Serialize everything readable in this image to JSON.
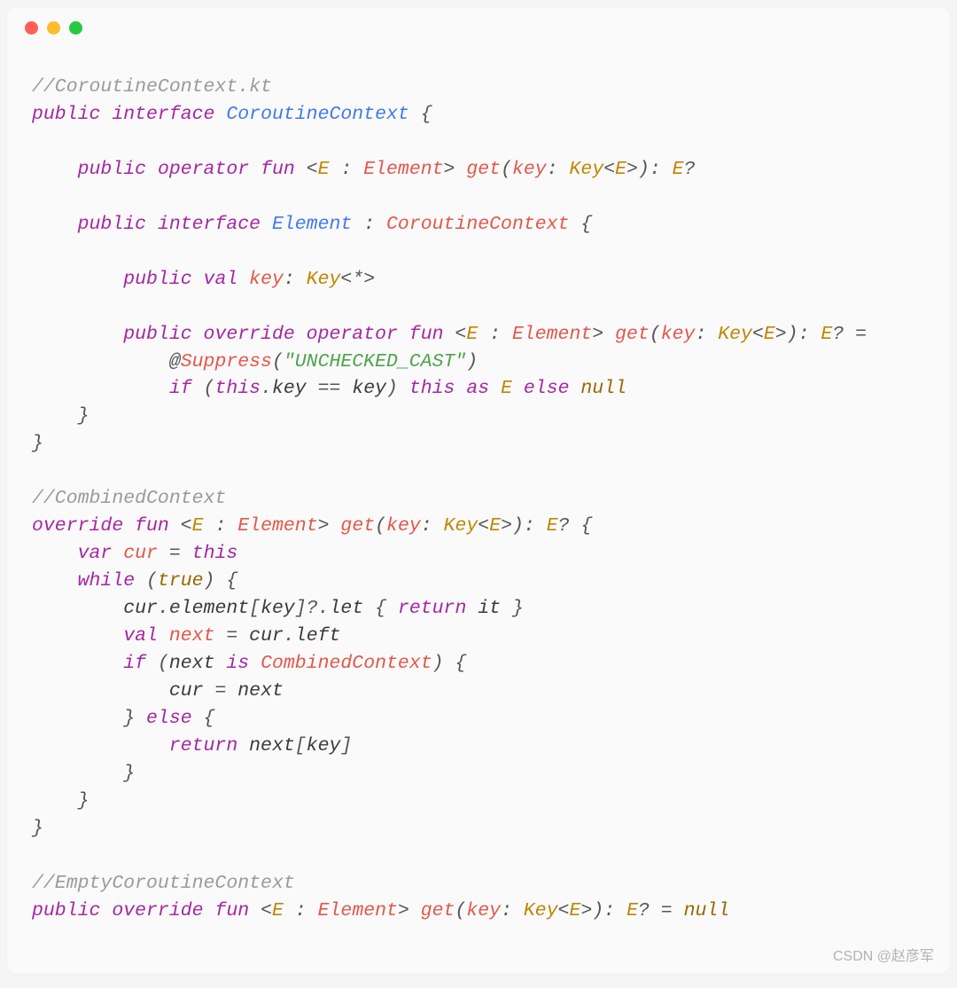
{
  "watermark": "CSDN @赵彦军",
  "code": {
    "lines": [
      [
        [
          "c-comment",
          "//CoroutineContext.kt"
        ]
      ],
      [
        [
          "c-kw",
          "public"
        ],
        [
          "sp",
          " "
        ],
        [
          "c-kw",
          "interface"
        ],
        [
          "sp",
          " "
        ],
        [
          "c-class",
          "CoroutineContext"
        ],
        [
          "sp",
          " "
        ],
        [
          "c-punc",
          "{"
        ]
      ],
      [],
      [
        [
          "sp",
          "    "
        ],
        [
          "c-kw",
          "public"
        ],
        [
          "sp",
          " "
        ],
        [
          "c-kw",
          "operator"
        ],
        [
          "sp",
          " "
        ],
        [
          "c-kw",
          "fun"
        ],
        [
          "sp",
          " "
        ],
        [
          "c-punc",
          "<"
        ],
        [
          "c-type",
          "E"
        ],
        [
          "sp",
          " "
        ],
        [
          "c-punc",
          ":"
        ],
        [
          "sp",
          " "
        ],
        [
          "c-fn",
          "Element"
        ],
        [
          "c-punc",
          ">"
        ],
        [
          "sp",
          " "
        ],
        [
          "c-fn",
          "get"
        ],
        [
          "c-punc",
          "("
        ],
        [
          "c-param",
          "key"
        ],
        [
          "c-punc",
          ":"
        ],
        [
          "sp",
          " "
        ],
        [
          "c-type",
          "Key"
        ],
        [
          "c-punc",
          "<"
        ],
        [
          "c-type",
          "E"
        ],
        [
          "c-punc",
          ">):"
        ],
        [
          "sp",
          " "
        ],
        [
          "c-type",
          "E"
        ],
        [
          "c-punc",
          "?"
        ]
      ],
      [],
      [
        [
          "sp",
          "    "
        ],
        [
          "c-kw",
          "public"
        ],
        [
          "sp",
          " "
        ],
        [
          "c-kw",
          "interface"
        ],
        [
          "sp",
          " "
        ],
        [
          "c-class",
          "Element"
        ],
        [
          "sp",
          " "
        ],
        [
          "c-punc",
          ":"
        ],
        [
          "sp",
          " "
        ],
        [
          "c-fn",
          "CoroutineContext"
        ],
        [
          "sp",
          " "
        ],
        [
          "c-punc",
          "{"
        ]
      ],
      [],
      [
        [
          "sp",
          "        "
        ],
        [
          "c-kw",
          "public"
        ],
        [
          "sp",
          " "
        ],
        [
          "c-kw",
          "val"
        ],
        [
          "sp",
          " "
        ],
        [
          "c-param",
          "key"
        ],
        [
          "c-punc",
          ":"
        ],
        [
          "sp",
          " "
        ],
        [
          "c-type",
          "Key"
        ],
        [
          "c-punc",
          "<*>"
        ]
      ],
      [],
      [
        [
          "sp",
          "        "
        ],
        [
          "c-kw",
          "public"
        ],
        [
          "sp",
          " "
        ],
        [
          "c-kw",
          "override"
        ],
        [
          "sp",
          " "
        ],
        [
          "c-kw",
          "operator"
        ],
        [
          "sp",
          " "
        ],
        [
          "c-kw",
          "fun"
        ],
        [
          "sp",
          " "
        ],
        [
          "c-punc",
          "<"
        ],
        [
          "c-type",
          "E"
        ],
        [
          "sp",
          " "
        ],
        [
          "c-punc",
          ":"
        ],
        [
          "sp",
          " "
        ],
        [
          "c-fn",
          "Element"
        ],
        [
          "c-punc",
          ">"
        ],
        [
          "sp",
          " "
        ],
        [
          "c-fn",
          "get"
        ],
        [
          "c-punc",
          "("
        ],
        [
          "c-param",
          "key"
        ],
        [
          "c-punc",
          ":"
        ],
        [
          "sp",
          " "
        ],
        [
          "c-type",
          "Key"
        ],
        [
          "c-punc",
          "<"
        ],
        [
          "c-type",
          "E"
        ],
        [
          "c-punc",
          ">):"
        ],
        [
          "sp",
          " "
        ],
        [
          "c-type",
          "E"
        ],
        [
          "c-punc",
          "?"
        ],
        [
          "sp",
          " "
        ],
        [
          "c-op",
          "="
        ]
      ],
      [
        [
          "sp",
          "            "
        ],
        [
          "c-punc",
          "@"
        ],
        [
          "c-fn",
          "Suppress"
        ],
        [
          "c-punc",
          "("
        ],
        [
          "c-str",
          "\"UNCHECKED_CAST\""
        ],
        [
          "c-punc",
          ")"
        ]
      ],
      [
        [
          "sp",
          "            "
        ],
        [
          "c-kw",
          "if"
        ],
        [
          "sp",
          " "
        ],
        [
          "c-punc",
          "("
        ],
        [
          "c-kw",
          "this"
        ],
        [
          "c-punc",
          "."
        ],
        [
          "c-id",
          "key"
        ],
        [
          "sp",
          " "
        ],
        [
          "c-op",
          "=="
        ],
        [
          "sp",
          " "
        ],
        [
          "c-id",
          "key"
        ],
        [
          "c-punc",
          ")"
        ],
        [
          "sp",
          " "
        ],
        [
          "c-kw",
          "this"
        ],
        [
          "sp",
          " "
        ],
        [
          "c-kw",
          "as"
        ],
        [
          "sp",
          " "
        ],
        [
          "c-type",
          "E"
        ],
        [
          "sp",
          " "
        ],
        [
          "c-kw",
          "else"
        ],
        [
          "sp",
          " "
        ],
        [
          "c-const",
          "null"
        ]
      ],
      [
        [
          "sp",
          "    "
        ],
        [
          "c-punc",
          "}"
        ]
      ],
      [
        [
          "c-punc",
          "}"
        ]
      ],
      [],
      [
        [
          "c-comment",
          "//CombinedContext"
        ]
      ],
      [
        [
          "c-kw",
          "override"
        ],
        [
          "sp",
          " "
        ],
        [
          "c-kw",
          "fun"
        ],
        [
          "sp",
          " "
        ],
        [
          "c-punc",
          "<"
        ],
        [
          "c-type",
          "E"
        ],
        [
          "sp",
          " "
        ],
        [
          "c-punc",
          ":"
        ],
        [
          "sp",
          " "
        ],
        [
          "c-fn",
          "Element"
        ],
        [
          "c-punc",
          ">"
        ],
        [
          "sp",
          " "
        ],
        [
          "c-fn",
          "get"
        ],
        [
          "c-punc",
          "("
        ],
        [
          "c-param",
          "key"
        ],
        [
          "c-punc",
          ":"
        ],
        [
          "sp",
          " "
        ],
        [
          "c-type",
          "Key"
        ],
        [
          "c-punc",
          "<"
        ],
        [
          "c-type",
          "E"
        ],
        [
          "c-punc",
          ">):"
        ],
        [
          "sp",
          " "
        ],
        [
          "c-type",
          "E"
        ],
        [
          "c-punc",
          "?"
        ],
        [
          "sp",
          " "
        ],
        [
          "c-punc",
          "{"
        ]
      ],
      [
        [
          "sp",
          "    "
        ],
        [
          "c-kw",
          "var"
        ],
        [
          "sp",
          " "
        ],
        [
          "c-param",
          "cur"
        ],
        [
          "sp",
          " "
        ],
        [
          "c-op",
          "="
        ],
        [
          "sp",
          " "
        ],
        [
          "c-kw",
          "this"
        ]
      ],
      [
        [
          "sp",
          "    "
        ],
        [
          "c-kw",
          "while"
        ],
        [
          "sp",
          " "
        ],
        [
          "c-punc",
          "("
        ],
        [
          "c-const",
          "true"
        ],
        [
          "c-punc",
          ")"
        ],
        [
          "sp",
          " "
        ],
        [
          "c-punc",
          "{"
        ]
      ],
      [
        [
          "sp",
          "        "
        ],
        [
          "c-id",
          "cur"
        ],
        [
          "c-punc",
          "."
        ],
        [
          "c-id",
          "element"
        ],
        [
          "c-punc",
          "["
        ],
        [
          "c-id",
          "key"
        ],
        [
          "c-punc",
          "]?."
        ],
        [
          "c-id",
          "let"
        ],
        [
          "sp",
          " "
        ],
        [
          "c-punc",
          "{"
        ],
        [
          "sp",
          " "
        ],
        [
          "c-kw",
          "return"
        ],
        [
          "sp",
          " "
        ],
        [
          "c-id",
          "it"
        ],
        [
          "sp",
          " "
        ],
        [
          "c-punc",
          "}"
        ]
      ],
      [
        [
          "sp",
          "        "
        ],
        [
          "c-kw",
          "val"
        ],
        [
          "sp",
          " "
        ],
        [
          "c-param",
          "next"
        ],
        [
          "sp",
          " "
        ],
        [
          "c-op",
          "="
        ],
        [
          "sp",
          " "
        ],
        [
          "c-id",
          "cur"
        ],
        [
          "c-punc",
          "."
        ],
        [
          "c-id",
          "left"
        ]
      ],
      [
        [
          "sp",
          "        "
        ],
        [
          "c-kw",
          "if"
        ],
        [
          "sp",
          " "
        ],
        [
          "c-punc",
          "("
        ],
        [
          "c-id",
          "next"
        ],
        [
          "sp",
          " "
        ],
        [
          "c-kw",
          "is"
        ],
        [
          "sp",
          " "
        ],
        [
          "c-fn",
          "CombinedContext"
        ],
        [
          "c-punc",
          ")"
        ],
        [
          "sp",
          " "
        ],
        [
          "c-punc",
          "{"
        ]
      ],
      [
        [
          "sp",
          "            "
        ],
        [
          "c-id",
          "cur"
        ],
        [
          "sp",
          " "
        ],
        [
          "c-op",
          "="
        ],
        [
          "sp",
          " "
        ],
        [
          "c-id",
          "next"
        ]
      ],
      [
        [
          "sp",
          "        "
        ],
        [
          "c-punc",
          "}"
        ],
        [
          "sp",
          " "
        ],
        [
          "c-kw",
          "else"
        ],
        [
          "sp",
          " "
        ],
        [
          "c-punc",
          "{"
        ]
      ],
      [
        [
          "sp",
          "            "
        ],
        [
          "c-kw",
          "return"
        ],
        [
          "sp",
          " "
        ],
        [
          "c-id",
          "next"
        ],
        [
          "c-punc",
          "["
        ],
        [
          "c-id",
          "key"
        ],
        [
          "c-punc",
          "]"
        ]
      ],
      [
        [
          "sp",
          "        "
        ],
        [
          "c-punc",
          "}"
        ]
      ],
      [
        [
          "sp",
          "    "
        ],
        [
          "c-punc",
          "}"
        ]
      ],
      [
        [
          "c-punc",
          "}"
        ]
      ],
      [],
      [
        [
          "c-comment",
          "//EmptyCoroutineContext"
        ]
      ],
      [
        [
          "c-kw",
          "public"
        ],
        [
          "sp",
          " "
        ],
        [
          "c-kw",
          "override"
        ],
        [
          "sp",
          " "
        ],
        [
          "c-kw",
          "fun"
        ],
        [
          "sp",
          " "
        ],
        [
          "c-punc",
          "<"
        ],
        [
          "c-type",
          "E"
        ],
        [
          "sp",
          " "
        ],
        [
          "c-punc",
          ":"
        ],
        [
          "sp",
          " "
        ],
        [
          "c-fn",
          "Element"
        ],
        [
          "c-punc",
          ">"
        ],
        [
          "sp",
          " "
        ],
        [
          "c-fn",
          "get"
        ],
        [
          "c-punc",
          "("
        ],
        [
          "c-param",
          "key"
        ],
        [
          "c-punc",
          ":"
        ],
        [
          "sp",
          " "
        ],
        [
          "c-type",
          "Key"
        ],
        [
          "c-punc",
          "<"
        ],
        [
          "c-type",
          "E"
        ],
        [
          "c-punc",
          ">):"
        ],
        [
          "sp",
          " "
        ],
        [
          "c-type",
          "E"
        ],
        [
          "c-punc",
          "?"
        ],
        [
          "sp",
          " "
        ],
        [
          "c-op",
          "="
        ],
        [
          "sp",
          " "
        ],
        [
          "c-const",
          "null"
        ]
      ]
    ]
  }
}
